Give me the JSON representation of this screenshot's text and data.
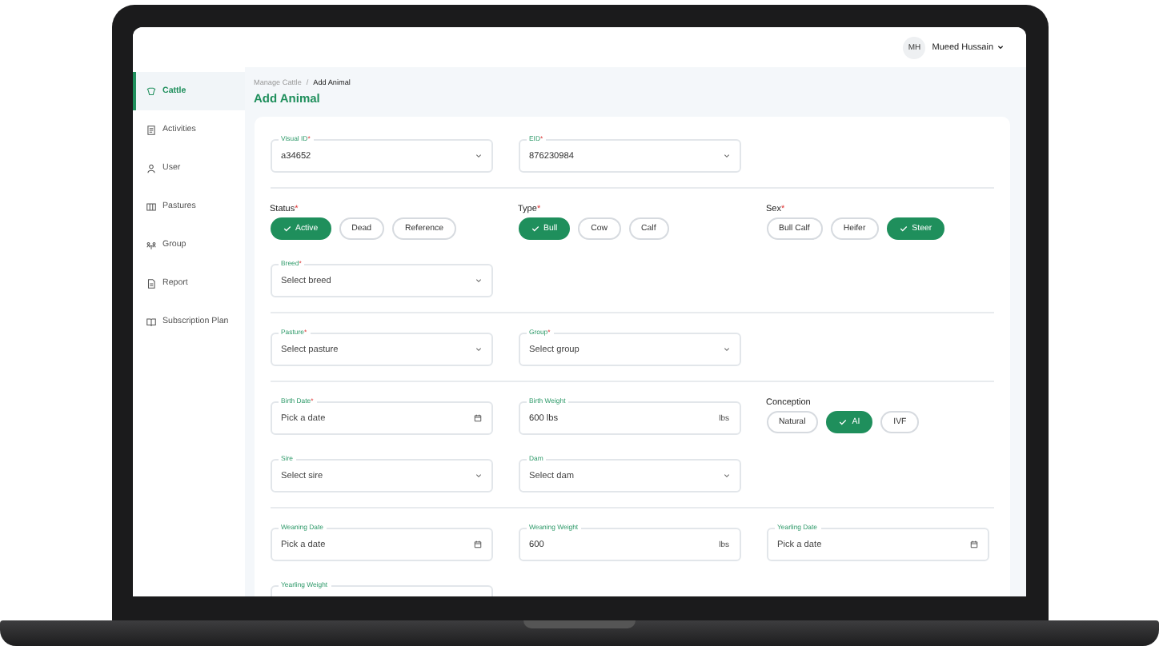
{
  "header": {
    "user_initials": "MH",
    "user_name": "Mueed Hussain"
  },
  "sidebar": {
    "items": [
      {
        "label": "Cattle",
        "selected": true
      },
      {
        "label": "Activities",
        "selected": false
      },
      {
        "label": "User",
        "selected": false
      },
      {
        "label": "Pastures",
        "selected": false
      },
      {
        "label": "Group",
        "selected": false
      },
      {
        "label": "Report",
        "selected": false
      },
      {
        "label": "Subscription Plan",
        "selected": false
      }
    ]
  },
  "breadcrumb": [
    "Manage Cattle",
    "/",
    "Add Animal"
  ],
  "page_title": "Add Animal",
  "form": {
    "groups": [
      {
        "rows": [
          [
            {
              "kind": "select",
              "label": "Visual ID",
              "mark": "*",
              "value": "a34652"
            },
            {
              "kind": "select",
              "label": "EID",
              "mark": "*",
              "value": "876230984"
            }
          ]
        ]
      },
      {
        "rows": [
          [
            {
              "kind": "choice",
              "label": "Status",
              "mark": "*",
              "options": [
                {
                  "label": "Active",
                  "selected": true
                },
                {
                  "label": "Dead",
                  "selected": false
                },
                {
                  "label": "Reference",
                  "selected": false
                }
              ]
            },
            {
              "kind": "choice",
              "label": "Type",
              "mark": "*",
              "options": [
                {
                  "label": "Bull",
                  "selected": true
                },
                {
                  "label": "Cow",
                  "selected": false
                },
                {
                  "label": "Calf",
                  "selected": false
                }
              ]
            },
            {
              "kind": "choice",
              "label": "Sex",
              "mark": "*",
              "options": [
                {
                  "label": "Bull Calf",
                  "selected": false
                },
                {
                  "label": "Heifer",
                  "selected": false
                },
                {
                  "label": "Steer",
                  "selected": true
                }
              ]
            }
          ],
          [
            {
              "kind": "select",
              "label": "Breed",
              "mark": "*",
              "placeholder": "Select breed"
            }
          ]
        ]
      },
      {
        "rows": [
          [
            {
              "kind": "select",
              "label": "Pasture",
              "mark": "*",
              "placeholder": "Select pasture"
            },
            {
              "kind": "select",
              "label": "Group",
              "mark": "*",
              "placeholder": "Select group"
            }
          ]
        ]
      },
      {
        "rows": [
          [
            {
              "kind": "date",
              "label": "Birth Date",
              "mark": "*",
              "placeholder": "Pick a date"
            },
            {
              "kind": "weight",
              "label": "Birth Weight",
              "value": "600 lbs",
              "unit": "lbs"
            },
            {
              "kind": "choice",
              "label": "Conception",
              "options": [
                {
                  "label": "Natural",
                  "selected": false
                },
                {
                  "label": "AI",
                  "selected": true
                },
                {
                  "label": "IVF",
                  "selected": false
                }
              ]
            }
          ],
          [
            {
              "kind": "select",
              "label": "Sire",
              "placeholder": "Select sire"
            },
            {
              "kind": "select",
              "label": "Dam",
              "placeholder": "Select dam"
            }
          ]
        ]
      },
      {
        "rows": [
          [
            {
              "kind": "date",
              "label": "Weaning Date",
              "placeholder": "Pick a date"
            },
            {
              "kind": "weight",
              "label": "Weaning Weight",
              "value": "600",
              "unit": "lbs"
            },
            {
              "kind": "date",
              "label": "Yearling Date",
              "placeholder": "Pick a date"
            }
          ],
          [
            {
              "kind": "weight",
              "label": "Yearling Weight"
            }
          ]
        ]
      }
    ]
  }
}
